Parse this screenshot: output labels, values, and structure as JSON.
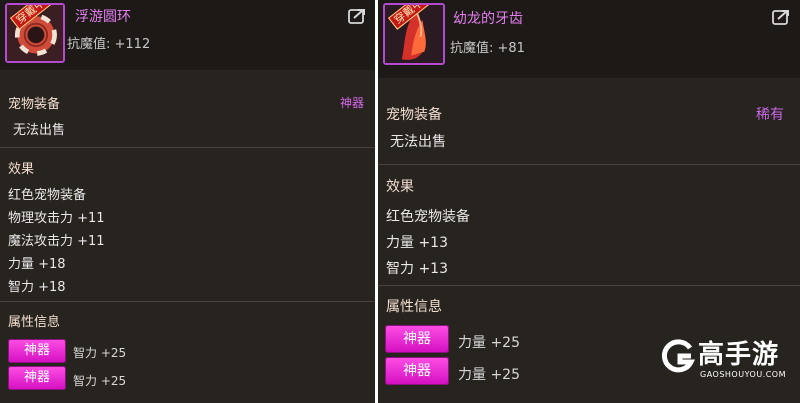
{
  "left_item": {
    "equipped_tag": "穿戴中",
    "name": "浮游圆环",
    "stat": "抗魔值: +112",
    "section_pet_equip": "宠物装备",
    "rarity": "神器",
    "sell_status": "无法出售",
    "section_effect": "效果",
    "effects": [
      "红色宠物装备",
      "物理攻击力 +11",
      "魔法攻击力 +11",
      "力量 +18",
      "智力 +18"
    ],
    "section_attr": "属性信息",
    "attrs": [
      {
        "badge": "神器",
        "value": "智力 +25"
      },
      {
        "badge": "神器",
        "value": "智力 +25"
      }
    ]
  },
  "right_item": {
    "equipped_tag": "穿戴中",
    "name": "幼龙的牙齿",
    "stat": "抗魔值: +81",
    "section_pet_equip": "宠物装备",
    "rarity": "稀有",
    "sell_status": "无法出售",
    "section_effect": "效果",
    "effects": [
      "红色宠物装备",
      "力量 +13",
      "智力 +13"
    ],
    "section_attr": "属性信息",
    "attrs": [
      {
        "badge": "神器",
        "value": "力量 +25"
      },
      {
        "badge": "神器",
        "value": "力量 +25"
      }
    ]
  },
  "watermark": {
    "brand": "高手游",
    "domain": "GAOSHOUYOU.COM"
  },
  "colors": {
    "panel_bg": "#27231f",
    "header_bg": "#1c1916",
    "item_name": "#e47ef0",
    "rarity": "#d368e8",
    "badge": "#ff3fe0"
  },
  "icons": [
    "share-icon",
    "ring-icon",
    "dragon-tooth-icon",
    "gaoshouyou-logo-icon"
  ]
}
